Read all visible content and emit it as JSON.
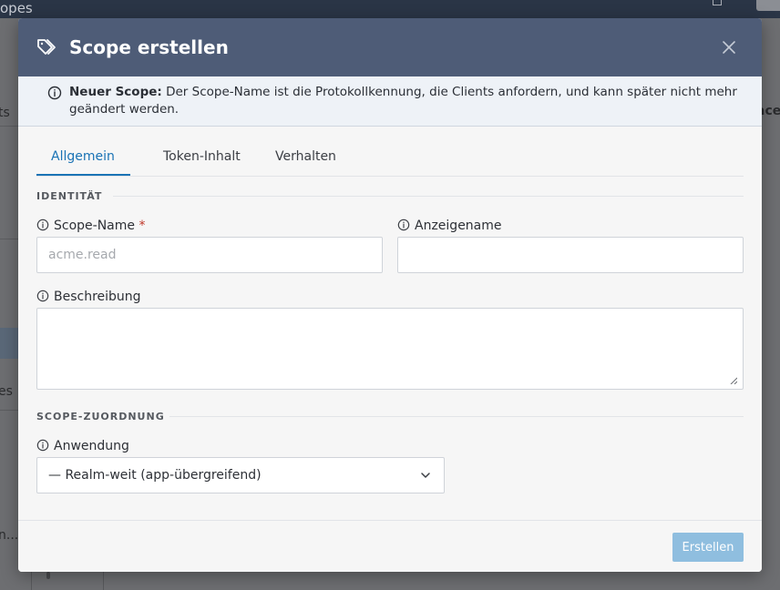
{
  "background": {
    "topbar_title": "opes",
    "side_text_1": "ts",
    "side_text_2": "es",
    "side_text_3": "n...",
    "right_text": "ace"
  },
  "modal": {
    "title": "Scope erstellen",
    "notice": {
      "label": "Neuer Scope:",
      "text": " Der Scope-Name ist die Protokollkennung, die Clients anfordern, und kann später nicht mehr geändert werden."
    },
    "tabs": [
      {
        "label": "Allgemein",
        "active": true
      },
      {
        "label": "Token-Inhalt",
        "active": false
      },
      {
        "label": "Verhalten",
        "active": false
      }
    ],
    "sections": {
      "identity": "IDENTITÄT",
      "assignment": "SCOPE-ZUORDNUNG"
    },
    "fields": {
      "scope_name": {
        "label": "Scope-Name",
        "required_marker": "*",
        "placeholder": "acme.read",
        "value": ""
      },
      "display_name": {
        "label": "Anzeigename",
        "value": ""
      },
      "description": {
        "label": "Beschreibung",
        "value": ""
      },
      "application": {
        "label": "Anwendung",
        "selected": "— Realm-weit (app-übergreifend)"
      }
    },
    "footer": {
      "create_label": "Erstellen"
    }
  },
  "colors": {
    "header": "#4e5c77",
    "accent": "#1a73b5",
    "primary_button_disabled": "#8fbedf",
    "required": "#c0392b"
  },
  "icons": [
    "tag-icon",
    "close-icon",
    "info-icon",
    "chevron-down-icon",
    "resize-grip-icon"
  ]
}
